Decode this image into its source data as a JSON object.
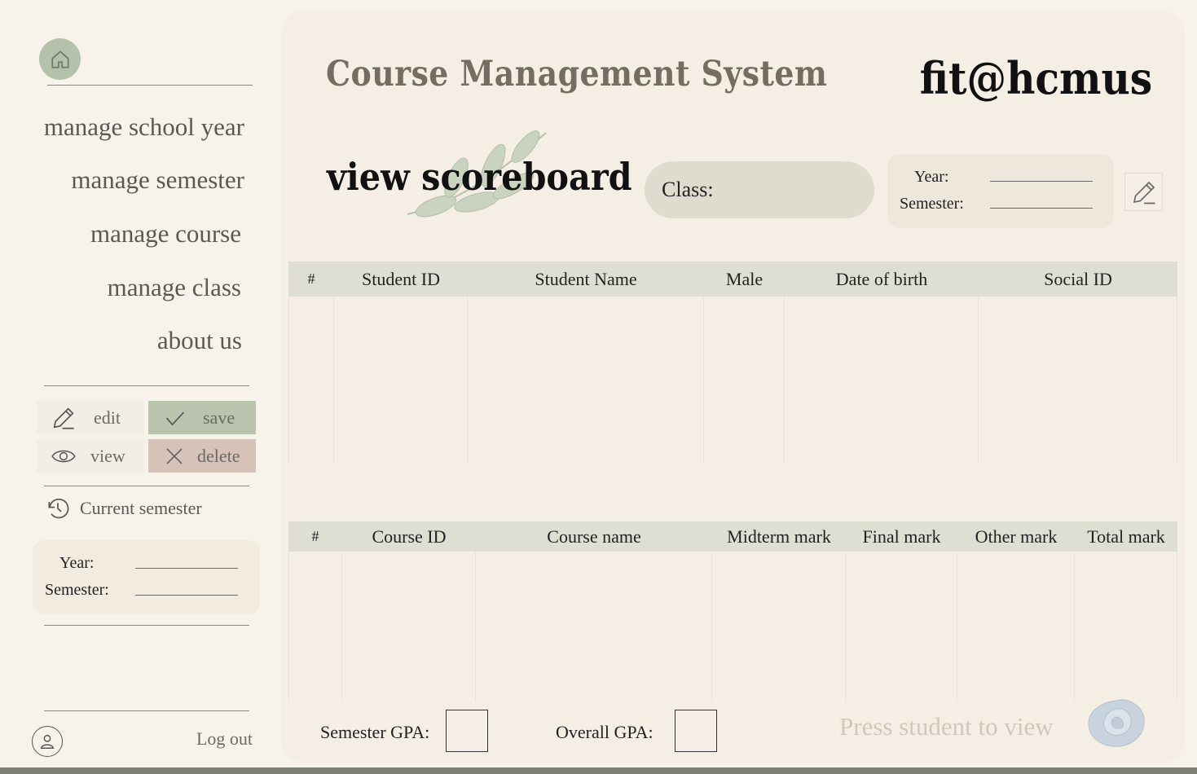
{
  "sidebar": {
    "nav": [
      "manage school year",
      "manage semester",
      "manage course",
      "manage class",
      "about us"
    ],
    "actions": {
      "edit": "edit",
      "save": "save",
      "view": "view",
      "delete": "delete"
    },
    "current_semester_label": "Current semester",
    "year_label": "Year:",
    "semester_label": "Semester:",
    "logout_label": "Log out"
  },
  "header": {
    "title": "Course Management System",
    "brand": "fit@hcmus"
  },
  "page": {
    "heading": "view scoreboard",
    "class_label": "Class:",
    "year_label": "Year:",
    "semester_label": "Semester:"
  },
  "student_table": {
    "columns": [
      "#",
      "Student ID",
      "Student Name",
      "Male",
      "Date of birth",
      "Social ID"
    ]
  },
  "course_table": {
    "columns": [
      "#",
      "Course ID",
      "Course name",
      "Midterm mark",
      "Final mark",
      "Other mark",
      "Total mark"
    ]
  },
  "footer": {
    "semester_gpa_label": "Semester GPA:",
    "overall_gpa_label": "Overall GPA:",
    "hint": "Press student to view"
  },
  "colors": {
    "background": "#f8f3ea",
    "panel": "#f4eee4",
    "save": "#b9c3ad",
    "delete": "#d6c2b8",
    "table_header": "#dedfd2"
  }
}
